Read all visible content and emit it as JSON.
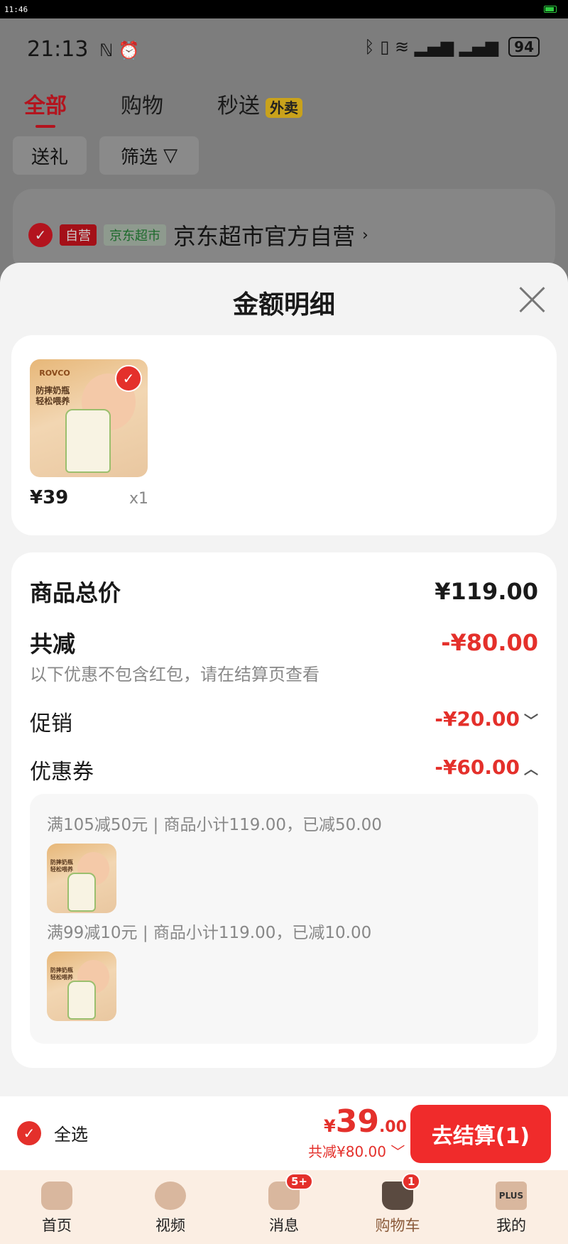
{
  "system": {
    "time": "11:46"
  },
  "status": {
    "time": "21:13",
    "icons": "ℕ ⏰",
    "right_icons": "ᛒ ▯ ≋ ▂▄▆ ▂▄▆",
    "battery": "94"
  },
  "tabs": [
    {
      "label": "全部"
    },
    {
      "label": "购物"
    },
    {
      "label": "秒送"
    }
  ],
  "tabs_badge": "外卖",
  "filters": {
    "gift": "送礼",
    "filter": "筛选",
    "filter_icon": "▽"
  },
  "store": {
    "check": "✓",
    "self_tag": "自营",
    "supermarket_tag": "京东超市",
    "name": "京东超市官方自营",
    "arrow": "›"
  },
  "sheet": {
    "title": "金额明细",
    "item": {
      "price": "¥39",
      "qty": "x1",
      "img_tag": "ROVCO",
      "img_text_1": "防摔奶瓶",
      "img_text_2": "轻松喂养"
    },
    "total_label": "商品总价",
    "total_value": "¥119.00",
    "reduce_label": "共减",
    "reduce_value": "-¥80.00",
    "reduce_note": "以下优惠不包含红包，请在结算页查看",
    "promo_label": "促销",
    "promo_value": "-¥20.00",
    "promo_chevron": "﹀",
    "coupon_label": "优惠券",
    "coupon_value": "-¥60.00",
    "coupon_chevron": "︿",
    "coupon_lines": [
      "满105减50元 | 商品小计119.00，已减50.00",
      "满99减10元 | 商品小计119.00，已减10.00"
    ]
  },
  "bottom": {
    "select_all": "全选",
    "price_yen": "¥",
    "price_int": "39",
    "price_cents": ".00",
    "saved": "共减¥80.00 ﹀",
    "checkout": "去结算(1)"
  },
  "nav": [
    {
      "label": "首页"
    },
    {
      "label": "视频"
    },
    {
      "label": "消息",
      "badge": "5+"
    },
    {
      "label": "购物车",
      "badge": "1"
    },
    {
      "label": "我的",
      "icon_text": "PLUS"
    }
  ],
  "colors": {
    "accent": "#e4302b",
    "checkout": "#f02b2b"
  }
}
